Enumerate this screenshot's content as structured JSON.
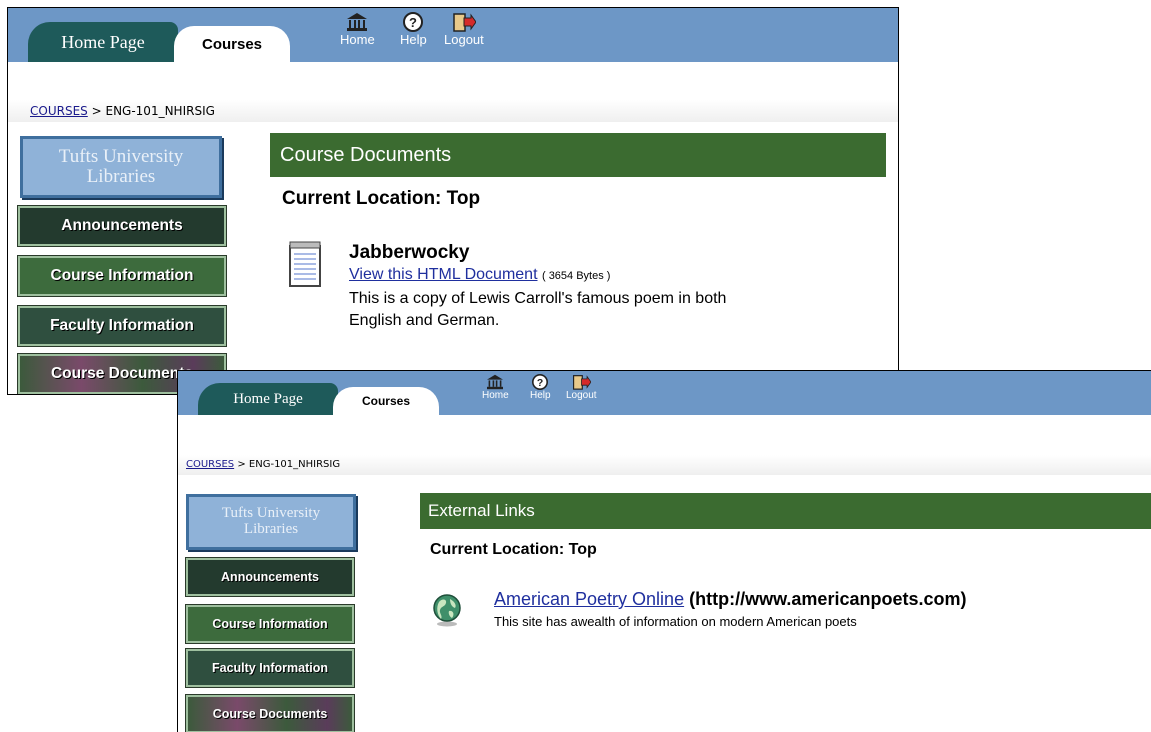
{
  "top_screenshot": {
    "tabs": {
      "home": "Home Page",
      "courses": "Courses"
    },
    "toolbar": {
      "home": "Home",
      "help": "Help",
      "logout": "Logout"
    },
    "breadcrumb": {
      "root": "COURSES",
      "sep": ">",
      "current": "ENG-101_NHIRSIG"
    },
    "libraries": {
      "line1": "Tufts University",
      "line2": "Libraries"
    },
    "nav": [
      "Announcements",
      "Course Information",
      "Faculty Information",
      "Course Documents"
    ],
    "section_title": "Course Documents",
    "location": "Current Location: Top",
    "item": {
      "title": "Jabberwocky",
      "link": "View this HTML Document",
      "size": "( 3654 Bytes )",
      "desc_line1": "This is a copy of Lewis Carroll's famous poem in both",
      "desc_line2": "English and German.",
      "icon": "document-icon"
    }
  },
  "bottom_screenshot": {
    "tabs": {
      "home": "Home Page",
      "courses": "Courses"
    },
    "toolbar": {
      "home": "Home",
      "help": "Help",
      "logout": "Logout"
    },
    "breadcrumb": {
      "root": "COURSES",
      "sep": ">",
      "current": "ENG-101_NHIRSIG"
    },
    "libraries": {
      "line1": "Tufts University",
      "line2": "Libraries"
    },
    "nav": [
      "Announcements",
      "Course Information",
      "Faculty Information",
      "Course Documents"
    ],
    "section_title": "External Links",
    "location": "Current Location: Top",
    "item": {
      "link": "American Poetry Online",
      "url": "(http://www.americanpoets.com)",
      "desc": "This site has awealth of information on modern American poets",
      "icon": "globe-icon"
    }
  },
  "colors": {
    "topbar": "#6d97c6",
    "header_green": "#3b6b30",
    "home_tab": "#1e5a5a",
    "link": "#1f2f9e"
  }
}
